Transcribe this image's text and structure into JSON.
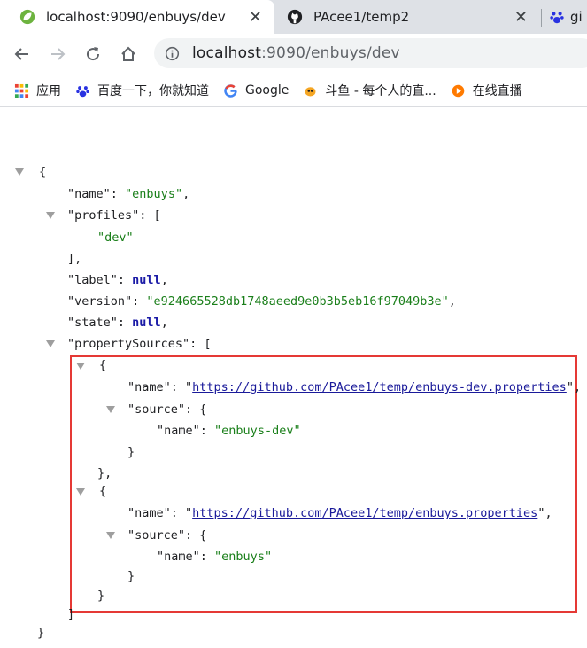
{
  "tabs": [
    {
      "title": "localhost:9090/enbuys/dev",
      "icon": "spring-leaf-icon",
      "active": true
    },
    {
      "title": "PAcee1/temp2",
      "icon": "github-icon",
      "active": false
    },
    {
      "title": "gi",
      "icon": "baidu-paw-icon",
      "active": false
    }
  ],
  "address": {
    "host": "localhost",
    "rest": ":9090/enbuys/dev"
  },
  "bookmarks": [
    {
      "label": "应用",
      "icon": "apps-grid-icon"
    },
    {
      "label": "百度一下，你就知道",
      "icon": "baidu-paw-icon"
    },
    {
      "label": "Google",
      "icon": "google-g-icon"
    },
    {
      "label": "斗鱼 - 每个人的直...",
      "icon": "douyu-fish-icon"
    },
    {
      "label": "在线直播",
      "icon": "live-icon"
    }
  ],
  "json": {
    "name_key": "\"name\"",
    "name_val": "\"enbuys\"",
    "profiles_key": "\"profiles\"",
    "profiles_val0": "\"dev\"",
    "label_key": "\"label\"",
    "label_val": "null",
    "version_key": "\"version\"",
    "version_val": "\"e924665528db1748aeed9e0b3b5eb16f97049b3e\"",
    "state_key": "\"state\"",
    "state_val": "null",
    "ps_key": "\"propertySources\"",
    "ps0_name_key": "\"name\"",
    "ps0_name_val": "https://github.com/PAcee1/temp/enbuys-dev.properties",
    "ps0_source_key": "\"source\"",
    "ps0_src_name_key": "\"name\"",
    "ps0_src_name_val": "\"enbuys-dev\"",
    "ps1_name_key": "\"name\"",
    "ps1_name_val": "https://github.com/PAcee1/temp/enbuys.properties",
    "ps1_source_key": "\"source\"",
    "ps1_src_name_key": "\"name\"",
    "ps1_src_name_val": "\"enbuys\""
  },
  "colors": {
    "highlight": "#e53935",
    "string": "#1a7f1a",
    "null": "#1a1aa6"
  }
}
